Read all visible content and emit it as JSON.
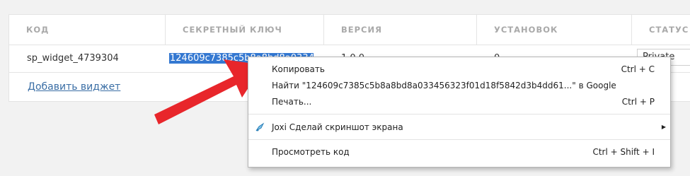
{
  "table": {
    "headers": [
      "КОД",
      "СЕКРЕТНЫЙ КЛЮЧ",
      "ВЕРСИЯ",
      "УСТАНОВОК",
      "СТАТУС"
    ],
    "row": {
      "code": "sp_widget_4739304",
      "secret_key": "124609c7385c5b8a8bd8a0334",
      "version": "1.0.0",
      "installs": "0",
      "status": "Private"
    },
    "add_widget": "Добавить виджет"
  },
  "context_menu": {
    "copy": {
      "label": "Копировать",
      "shortcut": "Ctrl + C"
    },
    "search": {
      "label": "Найти \"124609c7385c5b8a8bd8a033456323f01d18f5842d3b4dd61...\" в Google"
    },
    "print": {
      "label": "Печать...",
      "shortcut": "Ctrl + P"
    },
    "joxi": {
      "label": "Joxi Сделай скриншот экрана",
      "icon": "joxi-icon"
    },
    "view_source": {
      "label": "Просмотреть код",
      "shortcut": "Ctrl + Shift + I"
    }
  },
  "colors": {
    "selection": "#3478d1",
    "arrow": "#e8262b",
    "link": "#3a6ea5"
  }
}
